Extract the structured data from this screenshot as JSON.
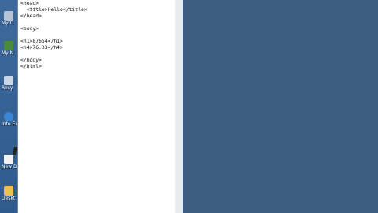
{
  "desktop": {
    "icons": [
      {
        "name": "my-computer-icon",
        "label": "My C",
        "color": "#b7c4d6"
      },
      {
        "name": "my-network-icon",
        "label": "My N",
        "color": "#4a8a3e"
      },
      {
        "name": "recycle-bin-icon",
        "label": "Recy",
        "color": "#c9d6e6"
      },
      {
        "name": "internet-explorer-icon",
        "label": "Inte Exp",
        "color": "#3b87d6"
      },
      {
        "name": "new-document-icon",
        "label": "New Docu",
        "color": "#f2f2f2"
      },
      {
        "name": "desktop-folder-icon",
        "label": "Deskt",
        "color": "#e8c24c"
      }
    ]
  },
  "editor": {
    "lines": [
      "<head>",
      "  <title>Hello</title>",
      "</head>",
      "",
      "<body>",
      "",
      "<h1>87654</h1>",
      "<h4>76.33</h4>",
      "",
      "</body>",
      "</html>"
    ]
  },
  "colors": {
    "desktop_bg": "#3b5d80",
    "editor_bg": "#ffffff"
  }
}
